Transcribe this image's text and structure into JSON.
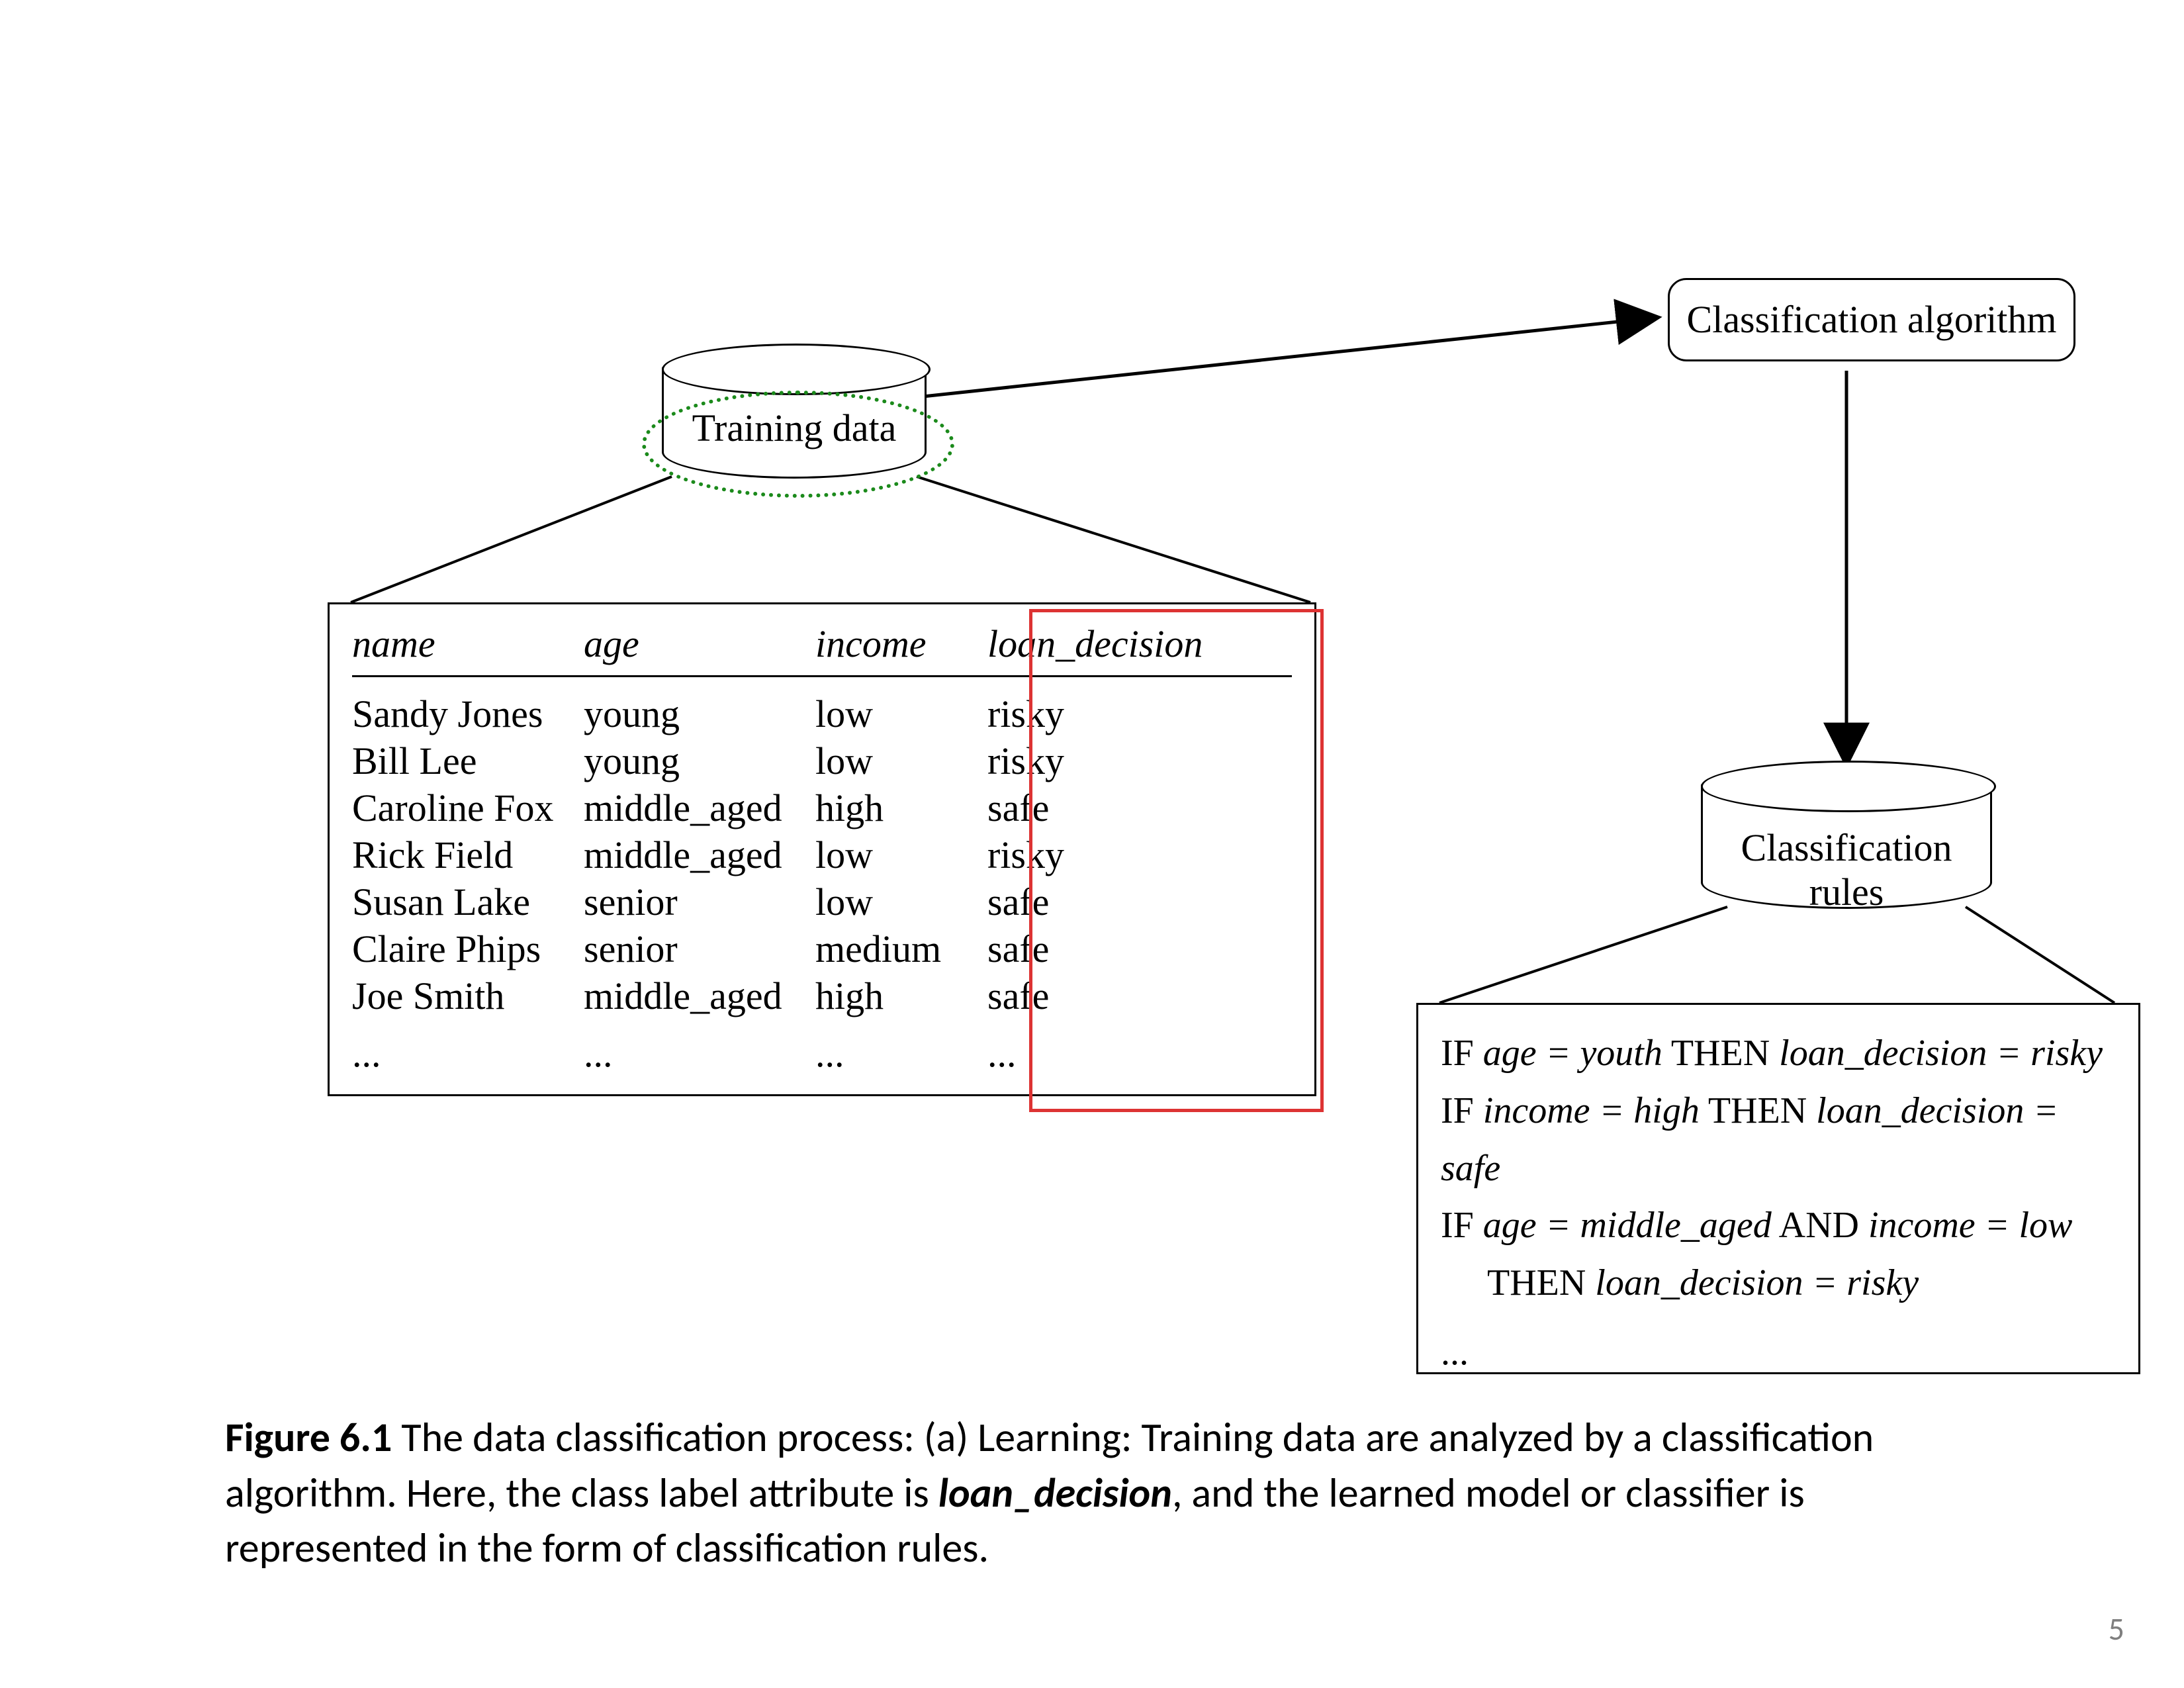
{
  "nodes": {
    "training_data_label": "Training data",
    "classification_algorithm_label": "Classification algorithm",
    "classification_rules_label": "Classification rules"
  },
  "table": {
    "headers": {
      "c1": "name",
      "c2": "age",
      "c3": "income",
      "c4": "loan_decision"
    },
    "rows": [
      {
        "c1": "Sandy Jones",
        "c2": "young",
        "c3": "low",
        "c4": "risky"
      },
      {
        "c1": "Bill Lee",
        "c2": "young",
        "c3": "low",
        "c4": "risky"
      },
      {
        "c1": "Caroline Fox",
        "c2": "middle_aged",
        "c3": "high",
        "c4": "safe"
      },
      {
        "c1": "Rick Field",
        "c2": "middle_aged",
        "c3": "low",
        "c4": "risky"
      },
      {
        "c1": "Susan Lake",
        "c2": "senior",
        "c3": "low",
        "c4": "safe"
      },
      {
        "c1": "Claire Phips",
        "c2": "senior",
        "c3": "medium",
        "c4": "safe"
      },
      {
        "c1": "Joe Smith",
        "c2": "middle_aged",
        "c3": "high",
        "c4": "safe"
      }
    ],
    "ellipsis": "..."
  },
  "rules": {
    "r1a": "IF ",
    "r1b": "age = youth",
    "r1c": " THEN ",
    "r1d": "loan_decision = risky",
    "r2a": "IF ",
    "r2b": "income = high",
    "r2c": " THEN ",
    "r2d": "loan_decision = safe",
    "r3a": "IF ",
    "r3b": "age = middle_aged",
    "r3c": " AND ",
    "r3d": "income = low",
    "r3e": "THEN ",
    "r3f": "loan_decision = risky",
    "ell": "..."
  },
  "caption": {
    "lead": "Figure 6.1",
    "text1": "  The data classification process: (a) Learning: Training data are analyzed by a classification algorithm. Here, the class label attribute is ",
    "em": "loan_decision",
    "text2": ", and the learned model or classifier is represented in the form of classification rules."
  },
  "page_number": "5"
}
